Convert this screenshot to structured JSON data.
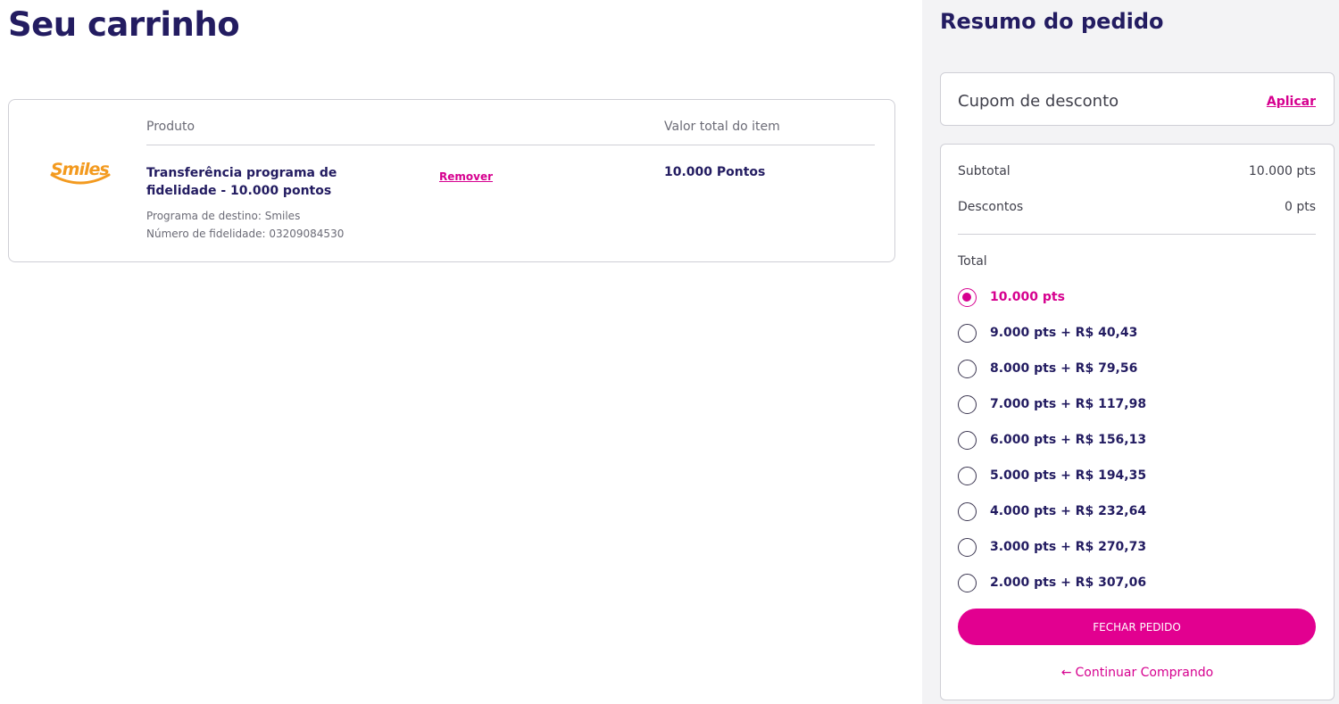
{
  "page": {
    "title": "Seu carrinho"
  },
  "cart": {
    "headers": {
      "product": "Produto",
      "item_total": "Valor total do item"
    },
    "item": {
      "logo_text": "Smiles",
      "name": "Transferência programa de fidelidade - 10.000 pontos",
      "remove_label": "Remover",
      "total": "10.000 Pontos",
      "destination": "Programa de destino: Smiles",
      "loyalty_number": "Número de fidelidade: 03209084530"
    }
  },
  "summary": {
    "title": "Resumo do pedido",
    "coupon": {
      "label": "Cupom de desconto",
      "apply_label": "Aplicar"
    },
    "subtotal": {
      "label": "Subtotal",
      "value": "10.000 pts"
    },
    "discounts": {
      "label": "Descontos",
      "value": "0 pts"
    },
    "total_label": "Total",
    "options": [
      {
        "label": "10.000 pts",
        "selected": true
      },
      {
        "label": "9.000 pts + R$ 40,43",
        "selected": false
      },
      {
        "label": "8.000 pts + R$ 79,56",
        "selected": false
      },
      {
        "label": "7.000 pts + R$ 117,98",
        "selected": false
      },
      {
        "label": "6.000 pts + R$ 156,13",
        "selected": false
      },
      {
        "label": "5.000 pts + R$ 194,35",
        "selected": false
      },
      {
        "label": "4.000 pts + R$ 232,64",
        "selected": false
      },
      {
        "label": "3.000 pts + R$ 270,73",
        "selected": false
      },
      {
        "label": "2.000 pts + R$ 307,06",
        "selected": false
      }
    ],
    "checkout_label": "FECHAR PEDIDO",
    "continue_label": "Continuar Comprando",
    "continue_icon": "arrow-left-icon"
  },
  "colors": {
    "accent": "#e20090",
    "navy": "#231c61",
    "logo_orange": "#f39a1f"
  }
}
